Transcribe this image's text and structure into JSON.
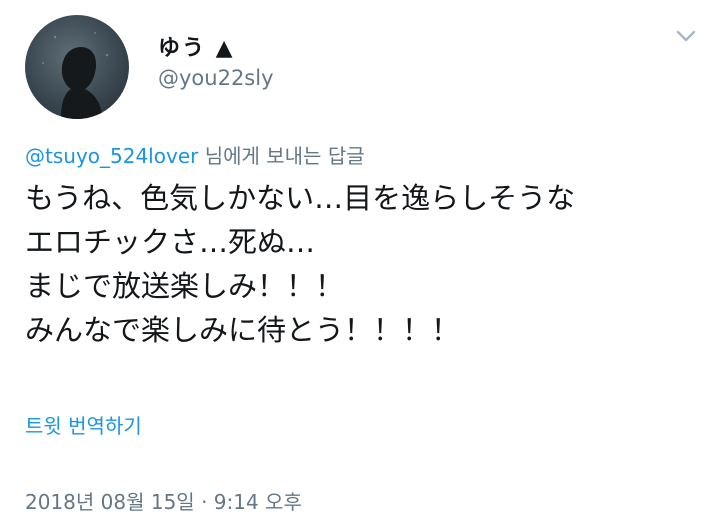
{
  "author": {
    "display_name": "ゆう ▲",
    "handle": "@you22sly"
  },
  "reply": {
    "to_user": "@tsuyo_524lover",
    "suffix": " 님에게 보내는 답글"
  },
  "tweet": {
    "lines": [
      "もうね、色気しかない…目を逸らしそうな",
      "エロチックさ…死ぬ…",
      "まじで放送楽しみ！！！",
      "みんなで楽しみに待とう！！！！"
    ]
  },
  "translate_label": "트윗 번역하기",
  "timestamp": "2018년 08월 15일 · 9:14 오후",
  "icons": {
    "avatar": "silhouette-avatar",
    "menu": "chevron-down-icon"
  },
  "colors": {
    "link": "#1b95e0",
    "secondary": "#657786",
    "text": "#14171a"
  }
}
